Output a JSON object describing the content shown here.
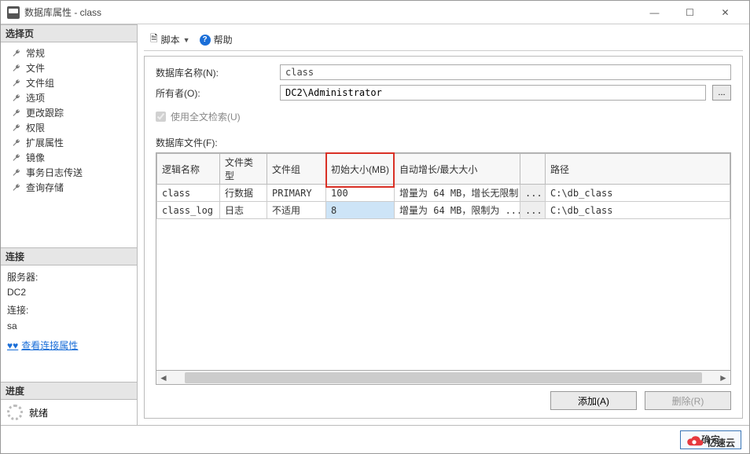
{
  "window": {
    "title": "数据库属性 - class"
  },
  "sidebar": {
    "select_pages_header": "选择页",
    "items": [
      {
        "label": "常规"
      },
      {
        "label": "文件"
      },
      {
        "label": "文件组"
      },
      {
        "label": "选项"
      },
      {
        "label": "更改跟踪"
      },
      {
        "label": "权限"
      },
      {
        "label": "扩展属性"
      },
      {
        "label": "镜像"
      },
      {
        "label": "事务日志传送"
      },
      {
        "label": "查询存储"
      }
    ],
    "connection_header": "连接",
    "server_label": "服务器:",
    "server_value": "DC2",
    "conn_label": "连接:",
    "conn_value": "sa",
    "view_props": "查看连接属性",
    "progress_header": "进度",
    "progress_status": "就绪"
  },
  "toolbar": {
    "script_label": "脚本",
    "help_label": "帮助"
  },
  "form": {
    "db_name_label": "数据库名称(N):",
    "db_name_value": "class",
    "owner_label": "所有者(O):",
    "owner_value": "DC2\\Administrator",
    "fulltext_label": "使用全文检索(U)",
    "files_label": "数据库文件(F):"
  },
  "grid": {
    "headers": {
      "logical_name": "逻辑名称",
      "file_type": "文件类型",
      "filegroup": "文件组",
      "init_size": "初始大小(MB)",
      "autogrowth": "自动增长/最大大小",
      "btn": "",
      "path": "路径"
    },
    "rows": [
      {
        "logical_name": "class",
        "file_type": "行数据",
        "filegroup": "PRIMARY",
        "init_size": "100",
        "autogrowth": "增量为 64 MB，增长无限制",
        "btn": "...",
        "path": "C:\\db_class"
      },
      {
        "logical_name": "class_log",
        "file_type": "日志",
        "filegroup": "不适用",
        "init_size": "8",
        "autogrowth": "增量为 64 MB，限制为 ...",
        "btn": "...",
        "path": "C:\\db_class"
      }
    ]
  },
  "buttons": {
    "add": "添加(A)",
    "remove": "删除(R)",
    "ok": "确定"
  },
  "brand": {
    "text": "亿速云"
  }
}
